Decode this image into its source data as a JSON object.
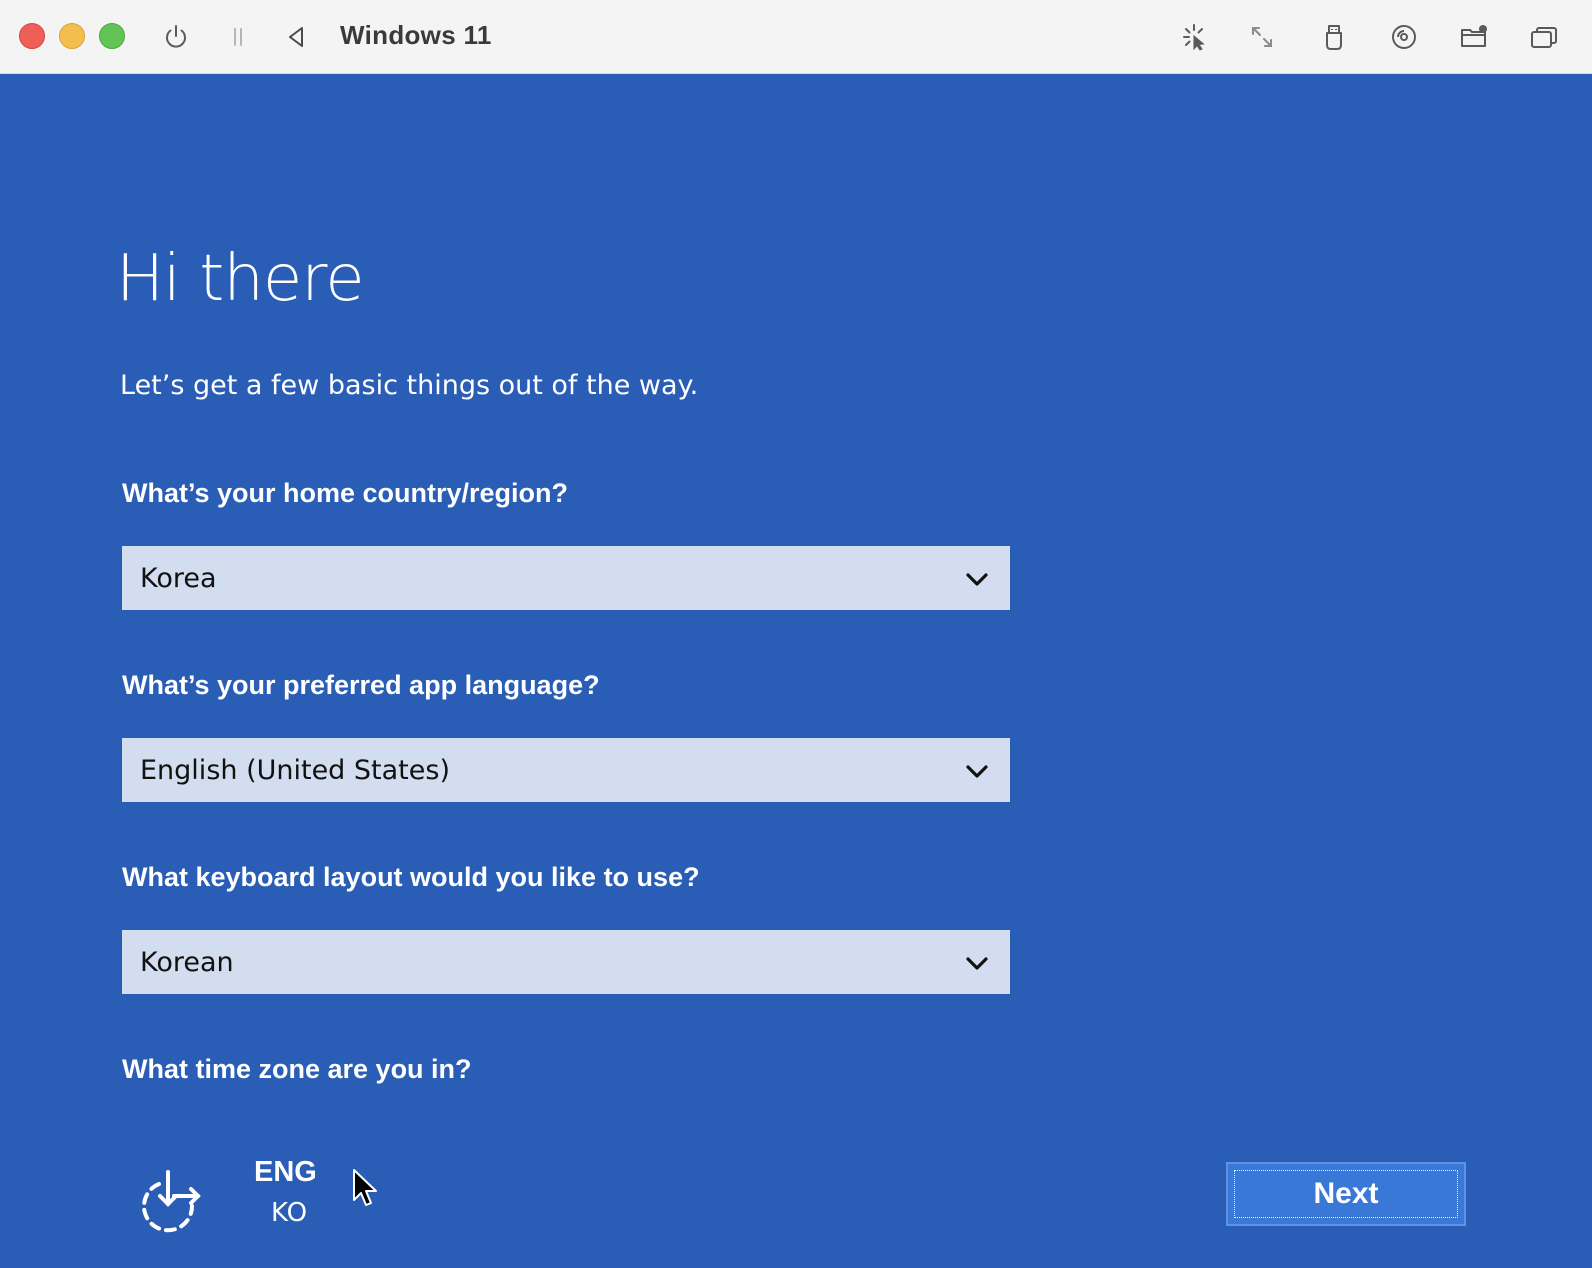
{
  "window": {
    "title": "Windows 11",
    "toolbar_icons": [
      "power-icon",
      "pause-icon",
      "back-triangle-icon",
      "capture-cursor-icon",
      "resize-icon",
      "usb-icon",
      "disc-icon",
      "shared-folder-icon",
      "windows-icon"
    ]
  },
  "oobe": {
    "heading": "Hi there",
    "subheading": "Let’s get a few basic things out of the way.",
    "country_question": "What’s your home country/region?",
    "country_value": "Korea",
    "language_question": "What’s your preferred app language?",
    "language_value": "English (United States)",
    "keyboard_question": "What keyboard layout would you like to use?",
    "keyboard_value": "Korean",
    "timezone_question": "What time zone are you in?",
    "input_lang_primary": "ENG",
    "input_lang_secondary": "KO",
    "next_label": "Next"
  },
  "colors": {
    "screen_bg": "#2a5db6",
    "dropdown_bg": "#d3ddf0",
    "button_bg": "#3a78d8"
  }
}
